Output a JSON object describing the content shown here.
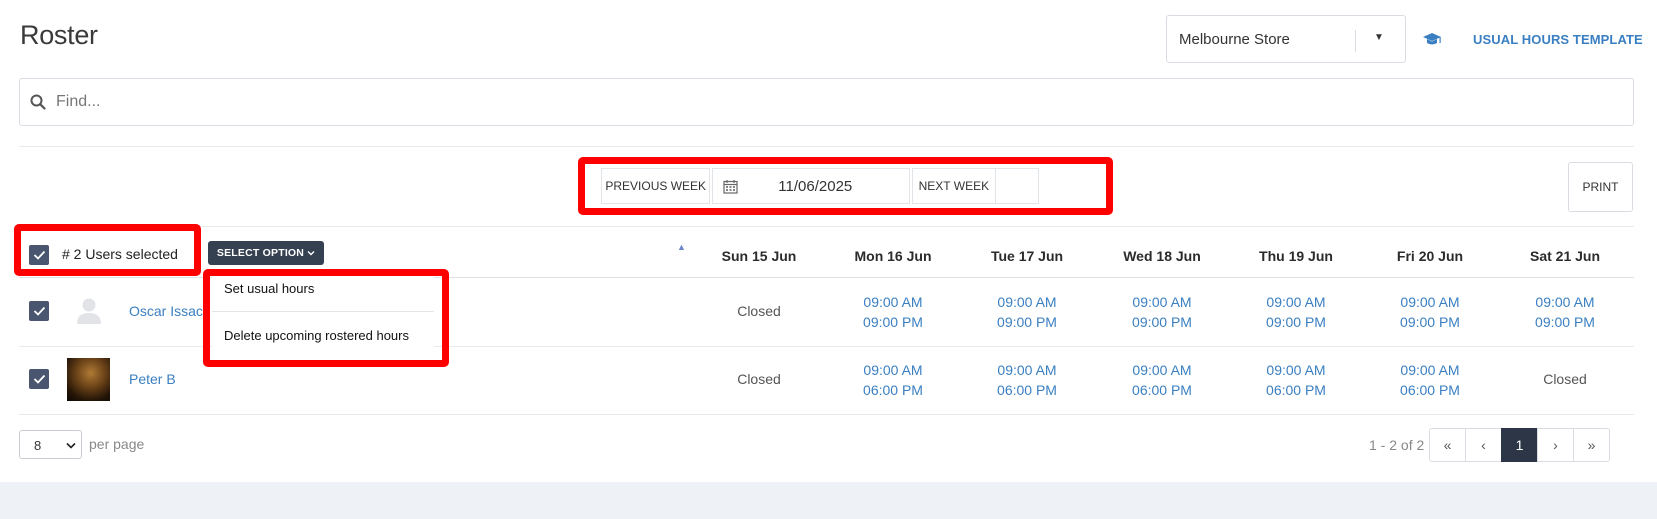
{
  "page": {
    "title": "Roster"
  },
  "header": {
    "store_value": "Melbourne Store",
    "template_link": "USUAL HOURS TEMPLATE"
  },
  "search": {
    "placeholder": "Find..."
  },
  "week_nav": {
    "prev_label": "PREVIOUS WEEK",
    "date_value": "11/06/2025",
    "next_label": "NEXT WEEK"
  },
  "print_label": "PRINT",
  "table": {
    "selection_text": "# 2 Users selected",
    "select_option_label": "SELECT OPTION",
    "days": [
      "Sun 15 Jun",
      "Mon 16 Jun",
      "Tue 17 Jun",
      "Wed 18 Jun",
      "Thu 19 Jun",
      "Fri 20 Jun",
      "Sat 21 Jun"
    ],
    "rows": [
      {
        "name": "Oscar Issac",
        "cells": [
          {
            "closed": "Closed"
          },
          {
            "start": "09:00 AM",
            "end": "09:00 PM"
          },
          {
            "start": "09:00 AM",
            "end": "09:00 PM"
          },
          {
            "start": "09:00 AM",
            "end": "09:00 PM"
          },
          {
            "start": "09:00 AM",
            "end": "09:00 PM"
          },
          {
            "start": "09:00 AM",
            "end": "09:00 PM"
          },
          {
            "start": "09:00 AM",
            "end": "09:00 PM"
          }
        ]
      },
      {
        "name": "Peter B",
        "cells": [
          {
            "closed": "Closed"
          },
          {
            "start": "09:00 AM",
            "end": "06:00 PM"
          },
          {
            "start": "09:00 AM",
            "end": "06:00 PM"
          },
          {
            "start": "09:00 AM",
            "end": "06:00 PM"
          },
          {
            "start": "09:00 AM",
            "end": "06:00 PM"
          },
          {
            "start": "09:00 AM",
            "end": "06:00 PM"
          },
          {
            "closed": "Closed"
          }
        ]
      }
    ]
  },
  "dropdown": {
    "items": [
      "Set usual hours",
      "Delete upcoming rostered hours"
    ]
  },
  "footer": {
    "per_page_value": "8",
    "per_page_label": "per page",
    "range_text": "1 - 2 of 2",
    "pagination": {
      "first": "«",
      "prev": "‹",
      "current": "1",
      "next": "›",
      "last": "»"
    }
  },
  "colors": {
    "accent": "#3a7fc1",
    "highlight": "#ff0000",
    "checkbox": "#4a5670",
    "active_page": "#2c3646"
  }
}
